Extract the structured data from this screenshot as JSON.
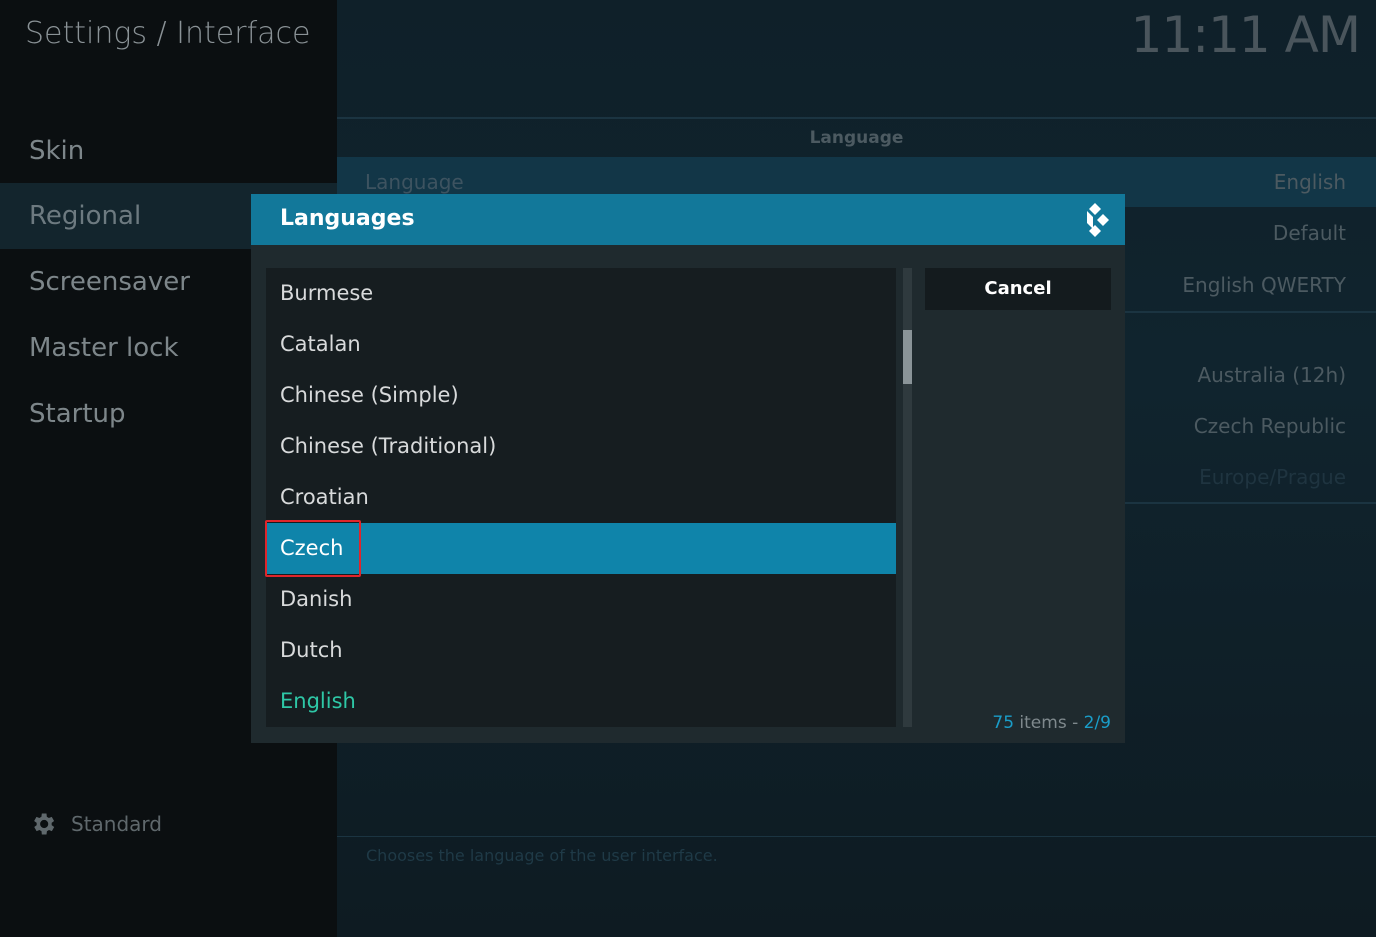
{
  "header": {
    "breadcrumb": "Settings / Interface",
    "clock": "11:11 AM"
  },
  "sidebar": {
    "items": [
      {
        "label": "Skin"
      },
      {
        "label": "Regional"
      },
      {
        "label": "Screensaver"
      },
      {
        "label": "Master lock"
      },
      {
        "label": "Startup"
      }
    ],
    "active_index": 1,
    "settings_level": "Standard"
  },
  "settings_panel": {
    "section_title": "Language",
    "rows": [
      {
        "label": "Language",
        "value": "English"
      },
      {
        "label": "",
        "value": "Default"
      },
      {
        "label": "",
        "value": "English QWERTY"
      },
      {
        "label": "",
        "value": "Australia (12h)"
      },
      {
        "label": "",
        "value": "Czech Republic"
      },
      {
        "label": "",
        "value": "Europe/Prague"
      }
    ],
    "description": "Chooses the language of the user interface."
  },
  "dialog": {
    "title": "Languages",
    "items": [
      {
        "label": "Burmese"
      },
      {
        "label": "Catalan"
      },
      {
        "label": "Chinese (Simple)"
      },
      {
        "label": "Chinese (Traditional)"
      },
      {
        "label": "Croatian"
      },
      {
        "label": "Czech"
      },
      {
        "label": "Danish"
      },
      {
        "label": "Dutch"
      },
      {
        "label": "English"
      }
    ],
    "selected_index": 5,
    "current_index": 8,
    "cancel_label": "Cancel",
    "count_number": "75",
    "count_items_label": "items -",
    "count_page": "2/9"
  },
  "colors": {
    "accent": "#12789a",
    "selection": "#0f84aa",
    "current_item": "#2ec7a6",
    "annotation_box": "#e0252b"
  },
  "icons": {
    "settings_level": "gear-icon",
    "dialog_logo": "kodi-logo-icon"
  }
}
